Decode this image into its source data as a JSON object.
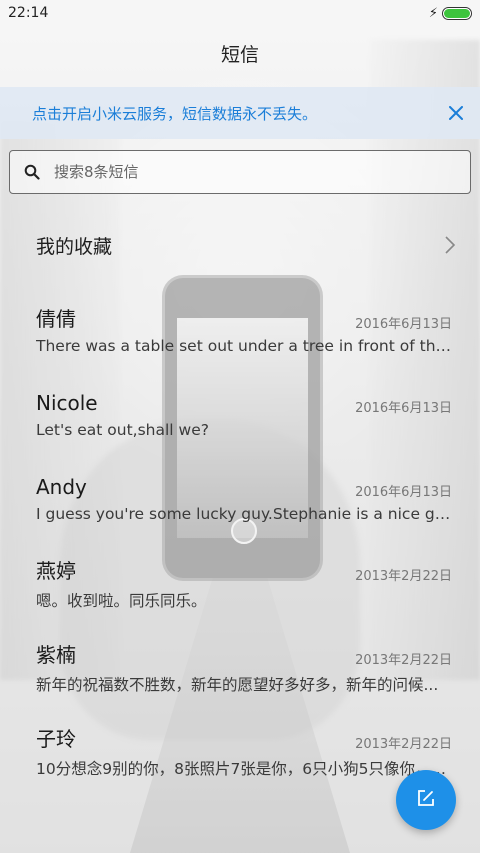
{
  "status_bar": {
    "time": "22:14",
    "battery_color": "#3cc43c"
  },
  "header": {
    "title": "短信"
  },
  "banner": {
    "message": "点击开启小米云服务，短信数据永不丢失。",
    "accent_color": "#1b7ed8",
    "close_icon": "close-icon"
  },
  "search": {
    "placeholder": "搜索8条短信",
    "value": ""
  },
  "favorites": {
    "label": "我的收藏"
  },
  "conversations": [
    {
      "name": "倩倩",
      "date": "2016年6月13日",
      "preview": "There was a table set out under a tree in front of the house..."
    },
    {
      "name": "Nicole",
      "date": "2016年6月13日",
      "preview": "Let's eat out,shall we?"
    },
    {
      "name": "Andy",
      "date": "2016年6月13日",
      "preview": "I guess you're some lucky guy.Stephanie is a nice girl."
    },
    {
      "name": "燕婷",
      "date": "2013年2月22日",
      "preview": "嗯。收到啦。同乐同乐。"
    },
    {
      "name": "紫楠",
      "date": "2013年2月22日",
      "preview": "新年的祝福数不胜数，新年的愿望好多好多，新年的问候..."
    },
    {
      "name": "子玲",
      "date": "2013年2月22日",
      "preview": "10分想念9别的你，8张照片7张是你，6只小狗5只像你，4..."
    }
  ],
  "fab": {
    "icon": "compose-icon",
    "color": "#1e90e8"
  }
}
